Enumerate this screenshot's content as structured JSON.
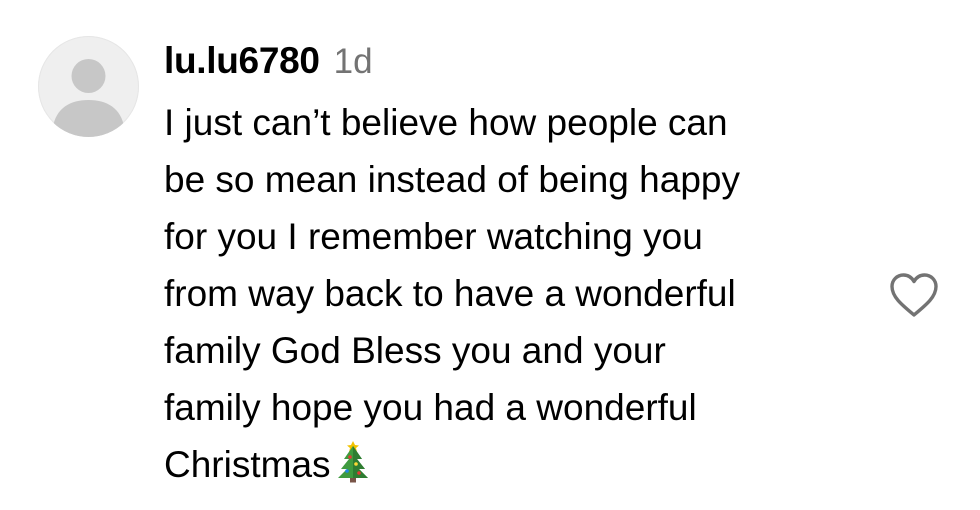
{
  "comment": {
    "username": "lu.lu6780",
    "timestamp": "1d",
    "text_lines": [
      "I just can’t believe how people can",
      "be so mean instead of being happy",
      "for you I remember watching you",
      "from way back to have a wonderful",
      "family God Bless you and your",
      "family hope you had a wonderful",
      "Christmas"
    ],
    "emoji": "christmas-tree-icon",
    "like_icon": "heart-outline-icon",
    "avatar_icon": "default-avatar-icon"
  },
  "colors": {
    "text": "#000000",
    "timestamp": "#737373",
    "avatar_bg": "#efefef",
    "avatar_fg": "#c7c7c7",
    "heart_stroke": "#737373"
  }
}
